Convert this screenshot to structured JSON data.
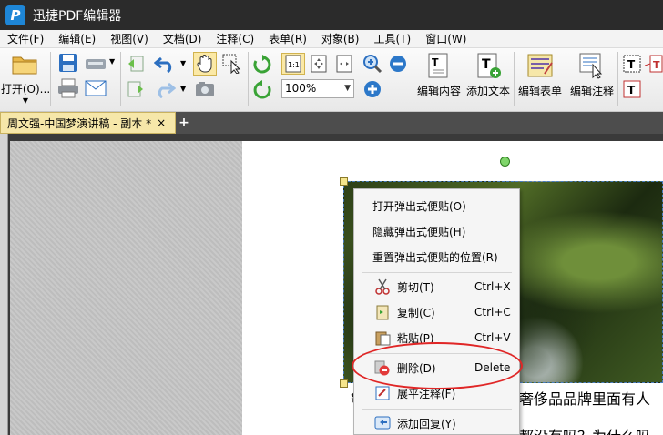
{
  "app": {
    "logo_letter": "P",
    "title": "迅捷PDF编辑器"
  },
  "menu": [
    "文件(F)",
    "编辑(E)",
    "视图(V)",
    "文档(D)",
    "注释(C)",
    "表单(R)",
    "对象(B)",
    "工具(T)",
    "窗口(W)"
  ],
  "toolbar": {
    "open_label": "打开(O)...",
    "zoom_value": "100%",
    "edit_content_label": "编辑内容",
    "add_text_label": "添加文本",
    "edit_form_label": "编辑表单",
    "edit_annotation_label": "编辑注释"
  },
  "tabs": {
    "doc_tab_label": "周文强-中国梦演讲稿 - 副本 *",
    "close": "×",
    "add": "+"
  },
  "document": {
    "line1": "奢侈品品牌里面有人",
    "line2": "都没有吗？为什么吗",
    "prefix": "鲁"
  },
  "context_menu": {
    "items": [
      {
        "label": "打开弹出式便贴(O)",
        "shortcut": ""
      },
      {
        "label": "隐藏弹出式便贴(H)",
        "shortcut": ""
      },
      {
        "label": "重置弹出式便贴的位置(R)",
        "shortcut": ""
      },
      {
        "label": "剪切(T)",
        "shortcut": "Ctrl+X"
      },
      {
        "label": "复制(C)",
        "shortcut": "Ctrl+C"
      },
      {
        "label": "粘贴(P)",
        "shortcut": "Ctrl+V"
      },
      {
        "label": "删除(D)",
        "shortcut": "Delete"
      },
      {
        "label": "展平注释(F)",
        "shortcut": ""
      },
      {
        "label": "添加回复(Y)",
        "shortcut": ""
      }
    ]
  },
  "colors": {
    "title_bg": "#2b2b2b",
    "tab_active": "#f6e7a9",
    "highlight": "#e02626",
    "accent_blue": "#1e86d6"
  }
}
